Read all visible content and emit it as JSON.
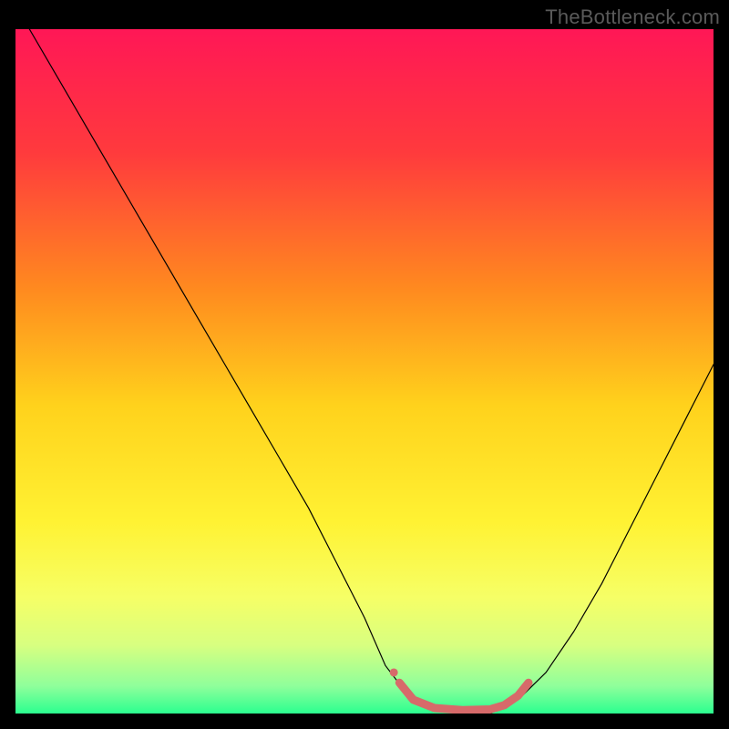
{
  "watermark": "TheBottleneck.com",
  "chart_data": {
    "type": "line",
    "title": "",
    "xlabel": "",
    "ylabel": "",
    "xlim": [
      0,
      100
    ],
    "ylim": [
      0,
      100
    ],
    "grid": false,
    "legend": false,
    "background_gradient": {
      "stops": [
        {
          "offset": 0.0,
          "color": "#ff1756"
        },
        {
          "offset": 0.18,
          "color": "#ff3a3d"
        },
        {
          "offset": 0.38,
          "color": "#ff8a1f"
        },
        {
          "offset": 0.55,
          "color": "#ffd21c"
        },
        {
          "offset": 0.72,
          "color": "#fff233"
        },
        {
          "offset": 0.83,
          "color": "#f6ff66"
        },
        {
          "offset": 0.9,
          "color": "#d8ff80"
        },
        {
          "offset": 0.96,
          "color": "#8fff9b"
        },
        {
          "offset": 1.0,
          "color": "#2bff8f"
        }
      ]
    },
    "series": [
      {
        "name": "bottleneck-curve",
        "stroke": "#000000",
        "stroke_width": 1.2,
        "x": [
          2,
          6,
          10,
          14,
          18,
          22,
          26,
          30,
          34,
          38,
          42,
          46,
          50,
          53,
          56,
          60,
          64,
          68,
          72,
          76,
          80,
          84,
          88,
          92,
          96,
          100
        ],
        "y": [
          100,
          93,
          86,
          79,
          72,
          65,
          58,
          51,
          44,
          37,
          30,
          22,
          14,
          7,
          3,
          1,
          0,
          0,
          2,
          6,
          12,
          19,
          27,
          35,
          43,
          51
        ]
      },
      {
        "name": "optimal-range",
        "stroke": "#d76a6a",
        "stroke_width": 9,
        "x": [
          55,
          57,
          60,
          64,
          68,
          70,
          72,
          73.5
        ],
        "y": [
          4.5,
          2.0,
          0.8,
          0.5,
          0.6,
          1.2,
          2.6,
          4.5
        ]
      }
    ],
    "markers": [
      {
        "name": "optimal-start-dot",
        "x": 54.2,
        "y": 6.0,
        "r": 4.5,
        "fill": "#d76a6a"
      }
    ]
  }
}
